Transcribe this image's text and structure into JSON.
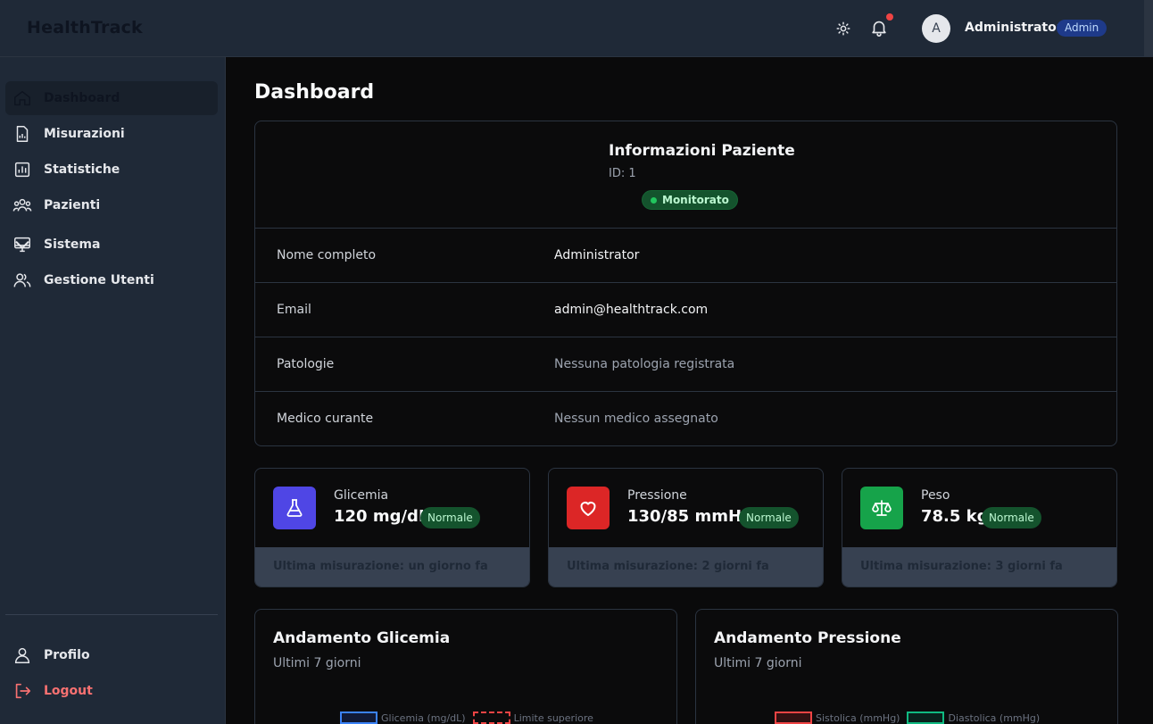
{
  "app": {
    "brand": "HealthTrack"
  },
  "header": {
    "avatar_initial": "A",
    "user_name": "Administrator",
    "role": "Admin",
    "notification_dot": true
  },
  "sidebar": {
    "items": [
      {
        "label": "Dashboard",
        "icon": "home-icon",
        "active": true
      },
      {
        "label": "Misurazioni",
        "icon": "document-chart-icon"
      },
      {
        "label": "Statistiche",
        "icon": "bar-chart-icon"
      },
      {
        "label": "Pazienti",
        "icon": "users-group-icon"
      },
      {
        "label": "Sistema",
        "icon": "monitor-icon",
        "expandable": true
      },
      {
        "label": "Gestione Utenti",
        "icon": "users-icon"
      }
    ],
    "bottom": [
      {
        "label": "Profilo",
        "icon": "user-icon"
      },
      {
        "label": "Logout",
        "icon": "logout-icon"
      }
    ]
  },
  "page": {
    "title": "Dashboard"
  },
  "patient": {
    "title": "Informazioni Paziente",
    "id": "ID: 1",
    "status": "Monitorato",
    "rows": [
      {
        "label": "Nome completo",
        "value": "Administrator"
      },
      {
        "label": "Email",
        "value": "admin@healthtrack.com"
      },
      {
        "label": "Patologie",
        "value": "Nessuna patologia registrata"
      },
      {
        "label": "Medico curante",
        "value": "Nessun medico assegnato"
      }
    ]
  },
  "metrics": [
    {
      "title": "Glicemia",
      "value": "120 mg/dL",
      "status": "Normale",
      "footer": "Ultima misurazione: un giorno fa",
      "color": "#4f46e5",
      "icon": "flask-icon"
    },
    {
      "title": "Pressione",
      "value": "130/85 mmHg",
      "status": "Normale",
      "footer": "Ultima misurazione: 2 giorni fa",
      "color": "#dc2626",
      "icon": "heart-icon"
    },
    {
      "title": "Peso",
      "value": "78.5 kg",
      "status": "Normale",
      "footer": "Ultima misurazione: 3 giorni fa",
      "color": "#16a34a",
      "icon": "scale-icon"
    }
  ],
  "charts": [
    {
      "title": "Andamento Glicemia",
      "subtitle": "Ultimi 7 giorni",
      "legend": [
        {
          "label": "Glicemia (mg/dL)",
          "color": "#3b82f6",
          "dashed": false
        },
        {
          "label": "Limite superiore",
          "color": "#ef4444",
          "dashed": true
        }
      ]
    },
    {
      "title": "Andamento Pressione",
      "subtitle": "Ultimi 7 giorni",
      "legend": [
        {
          "label": "Sistolica (mmHg)",
          "color": "#ef4444",
          "dashed": false
        },
        {
          "label": "Diastolica (mmHg)",
          "color": "#10b981",
          "dashed": false
        }
      ]
    }
  ]
}
